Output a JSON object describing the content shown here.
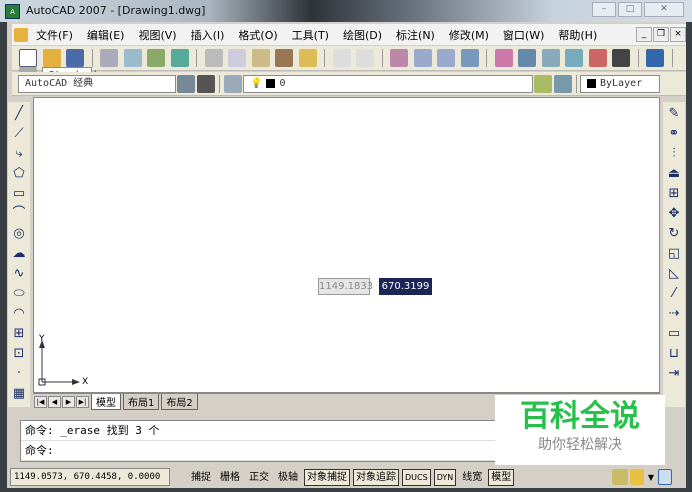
{
  "window": {
    "title": "AutoCAD 2007 - [Drawing1.dwg]",
    "app_icon": "acad"
  },
  "menu": [
    "文件(F)",
    "编辑(E)",
    "视图(V)",
    "插入(I)",
    "格式(O)",
    "工具(T)",
    "绘图(D)",
    "标注(N)",
    "修改(M)",
    "窗口(W)",
    "帮助(H)"
  ],
  "toolbar": {
    "text_style": "Standard",
    "workspace": "AutoCAD 经典",
    "layer": "0",
    "color": "ByLayer"
  },
  "drawing": {
    "ucs_x": "X",
    "ucs_y": "Y",
    "dyn_x": "1149.1833",
    "dyn_y": "670.3199"
  },
  "tabs": [
    "模型",
    "布局1",
    "布局2"
  ],
  "command": {
    "history": "命令: _erase 找到 3 个",
    "prompt": "命令:"
  },
  "status": {
    "coords": "1149.0573, 670.4458, 0.0000",
    "buttons": [
      {
        "label": "捕捉",
        "on": false
      },
      {
        "label": "栅格",
        "on": false
      },
      {
        "label": "正交",
        "on": false
      },
      {
        "label": "极轴",
        "on": false
      },
      {
        "label": "对象捕捉",
        "on": true
      },
      {
        "label": "对象追踪",
        "on": true
      },
      {
        "label": "DUCS",
        "on": true
      },
      {
        "label": "DYN",
        "on": true
      },
      {
        "label": "线宽",
        "on": false
      },
      {
        "label": "模型",
        "on": true
      }
    ]
  },
  "watermark": {
    "title": "百科全说",
    "subtitle": "助你轻松解决"
  },
  "colors": {
    "watermark": "#27c04a",
    "dyn_input": "#1c2556"
  }
}
